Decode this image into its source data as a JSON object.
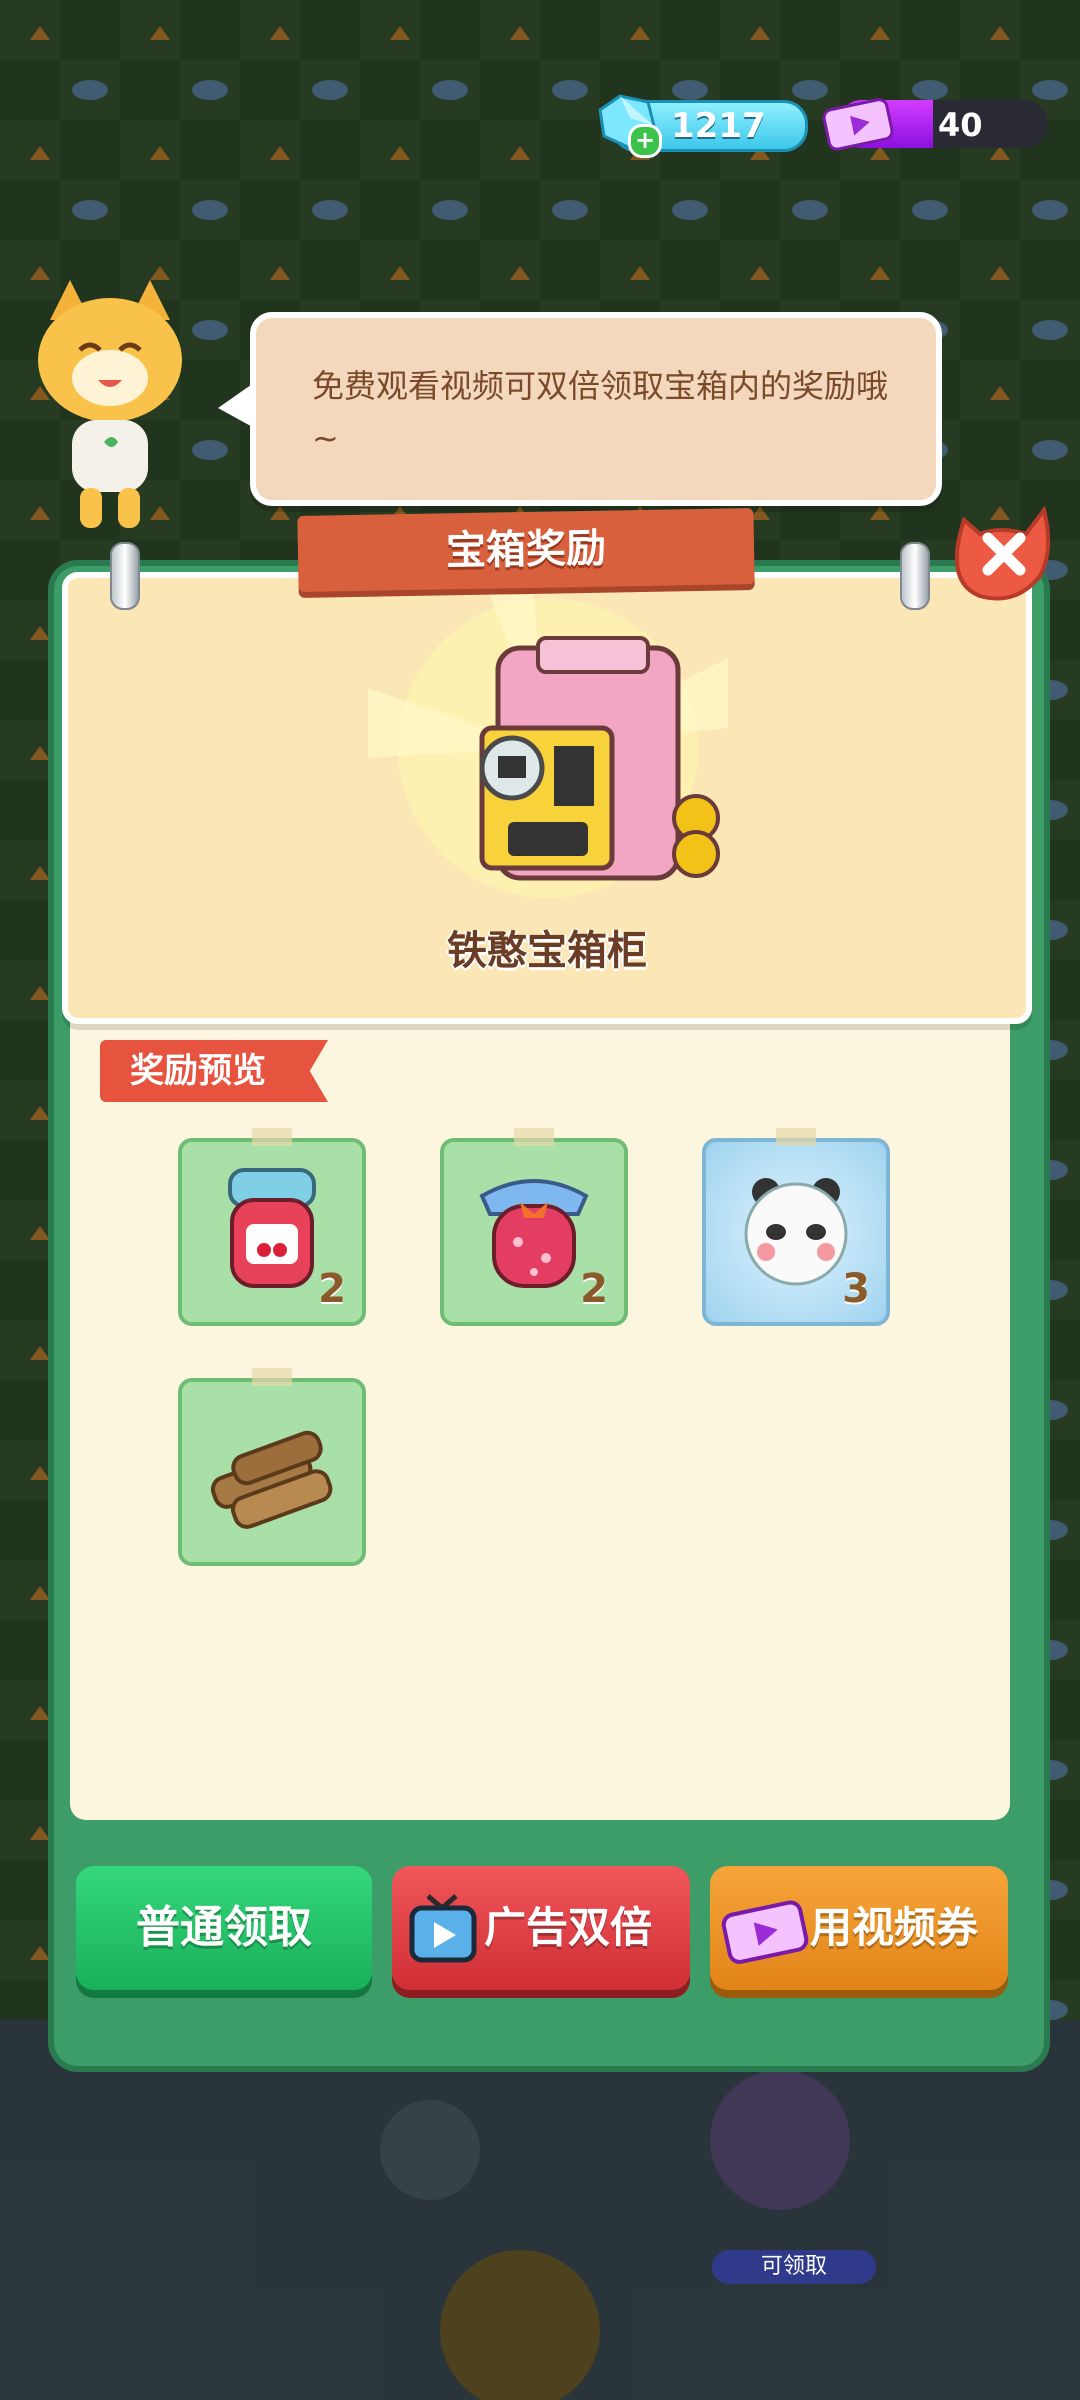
{
  "currency": {
    "gems": "1217",
    "tickets": "40"
  },
  "mascot": {
    "speech": "免费观看视频可双倍领取宝箱内的奖励哦~"
  },
  "panel": {
    "title": "宝箱奖励",
    "chest_name": "铁憨宝箱柜",
    "preview_label": "奖励预览"
  },
  "rewards": [
    {
      "item": "cherry-jam-icon",
      "qty": "2"
    },
    {
      "item": "strawberry-jam-icon",
      "qty": "2"
    },
    {
      "item": "panda-ball-icon",
      "qty": "3"
    },
    {
      "item": "wood-logs-icon",
      "qty": ""
    }
  ],
  "buttons": {
    "normal": "普通领取",
    "ad_double": "广告双倍",
    "use_ticket": "用视频券"
  },
  "background": {
    "claim_chip": "可领取"
  },
  "colors": {
    "green_button": "#19b05a",
    "red_button": "#cf2f35",
    "orange_button": "#e28418",
    "panel_green": "#3c9d68"
  }
}
